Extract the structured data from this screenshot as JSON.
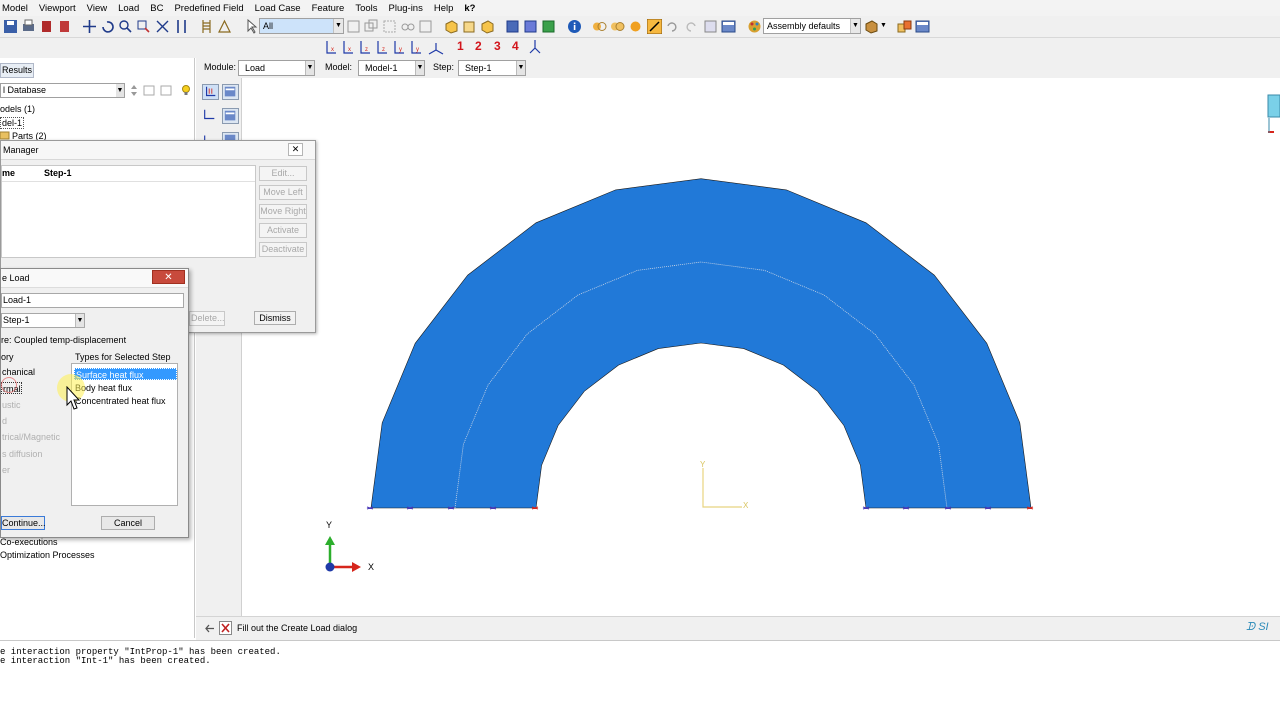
{
  "menu": [
    "Model",
    "Viewport",
    "View",
    "Load",
    "BC",
    "Predefined Field",
    "Load Case",
    "Feature",
    "Tools",
    "Plug-ins",
    "Help",
    "k?"
  ],
  "toolbar": {
    "selection_filter": "All",
    "render_style": "Assembly defaults",
    "step_numbers": [
      "1",
      "2",
      "3",
      "4"
    ]
  },
  "context": {
    "module_label": "Module:",
    "module_value": "Load",
    "model_label": "Model:",
    "model_value": "Model-1",
    "step_label": "Step:",
    "step_value": "Step-1"
  },
  "tree": {
    "results_tab": "Results",
    "database": "l Database",
    "items": [
      "odels (1)",
      "del-1",
      "Parts (2)",
      "Co-executions",
      "Optimization Processes"
    ]
  },
  "step_manager": {
    "title": "Manager",
    "col_name": "me",
    "col_step": "Step-1",
    "buttons": [
      "Edit...",
      "Move Left",
      "Move Right",
      "Activate",
      "Deactivate"
    ],
    "delete_label": "Delete...",
    "dismiss_label": "Dismiss"
  },
  "create_load": {
    "title": "e Load",
    "name_value": "Load-1",
    "step_value": "Step-1",
    "procedure_text": "re:  Coupled temp-displacement",
    "category_header": "ory",
    "types_header": "Types for Selected Step",
    "categories": [
      "chanical",
      "rmal",
      "ustic",
      "d",
      "trical/Magnetic",
      "s diffusion",
      "er"
    ],
    "types": [
      "Surface heat flux",
      "Body heat flux",
      "Concentrated heat flux"
    ],
    "continue_label": "Continue...",
    "cancel_label": "Cancel"
  },
  "prompt": {
    "text": "Fill out the Create Load dialog"
  },
  "messages": [
    "e interaction property \"IntProp-1\" has been created.",
    "e interaction \"Int-1\" has been created."
  ],
  "viewport": {
    "part_color": "#2179d8",
    "triad_labels": [
      "Y",
      "X"
    ],
    "origin_labels": [
      "Y",
      "X"
    ],
    "brand": "SI"
  },
  "colors": {
    "selection": "#3399ff",
    "triad_x": "#d6261c",
    "triad_y": "#2cae2c",
    "triad_z": "#1f3aa8"
  }
}
